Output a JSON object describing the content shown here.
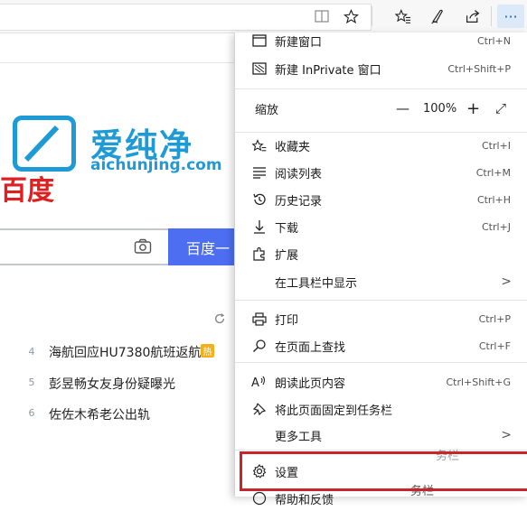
{
  "toolbar": {
    "icons": [
      "reader-icon",
      "favorite-star-icon",
      "favorites-list-icon",
      "pen-icon",
      "share-icon",
      "more-icon"
    ],
    "more_label": "···"
  },
  "page": {
    "watermark_text": "爱纯净",
    "watermark_url": "aichunjing.com",
    "baidu_logo": "百度",
    "search_button": "百度一",
    "news": [
      {
        "num": "4",
        "text": "海航回应HU7380航班返航",
        "badge": "热"
      },
      {
        "num": "5",
        "text": "彭昱畅女友身份疑曝光"
      },
      {
        "num": "6",
        "text": "佐佐木希老公出轨"
      }
    ]
  },
  "menu": {
    "items_top": [
      {
        "icon": "new-window-icon",
        "label": "新建窗口",
        "shortcut": "Ctrl+N"
      },
      {
        "icon": "inprivate-icon",
        "label": "新建 InPrivate 窗口",
        "shortcut": "Ctrl+Shift+P"
      }
    ],
    "zoom": {
      "label": "缩放",
      "minus": "—",
      "value": "100%",
      "plus": "+",
      "fullscreen": "⤢"
    },
    "items_mid": [
      {
        "icon": "favorites-icon",
        "label": "收藏夹",
        "shortcut": "Ctrl+I"
      },
      {
        "icon": "reading-list-icon",
        "label": "阅读列表",
        "shortcut": "Ctrl+M"
      },
      {
        "icon": "history-icon",
        "label": "历史记录",
        "shortcut": "Ctrl+H"
      },
      {
        "icon": "download-icon",
        "label": "下载",
        "shortcut": "Ctrl+J"
      },
      {
        "icon": "extensions-icon",
        "label": "扩展",
        "shortcut": ""
      },
      {
        "icon": "",
        "label": "在工具栏中显示",
        "shortcut": "",
        "arrow": ">"
      }
    ],
    "items_print": [
      {
        "icon": "print-icon",
        "label": "打印",
        "shortcut": "Ctrl+P"
      },
      {
        "icon": "find-icon",
        "label": "在页面上查找",
        "shortcut": "Ctrl+F"
      }
    ],
    "items_tools": [
      {
        "icon": "read-aloud-icon",
        "label": "朗读此页内容",
        "shortcut": "Ctrl+Shift+G"
      },
      {
        "icon": "pin-icon",
        "label": "将此页面固定到任务栏",
        "shortcut": ""
      },
      {
        "icon": "",
        "label": "更多工具",
        "shortcut": "",
        "arrow": ">"
      }
    ],
    "settings": {
      "icon": "gear-icon",
      "label": "设置"
    },
    "help": {
      "icon": "help-icon",
      "label": "帮助和反馈"
    },
    "ghost_texts": [
      "务栏",
      "务栏"
    ]
  },
  "colors": {
    "accent": "#4e6ef2",
    "watermark": "#1e9bd7",
    "highlight": "#c9232b",
    "baidu_red": "#de2020"
  }
}
